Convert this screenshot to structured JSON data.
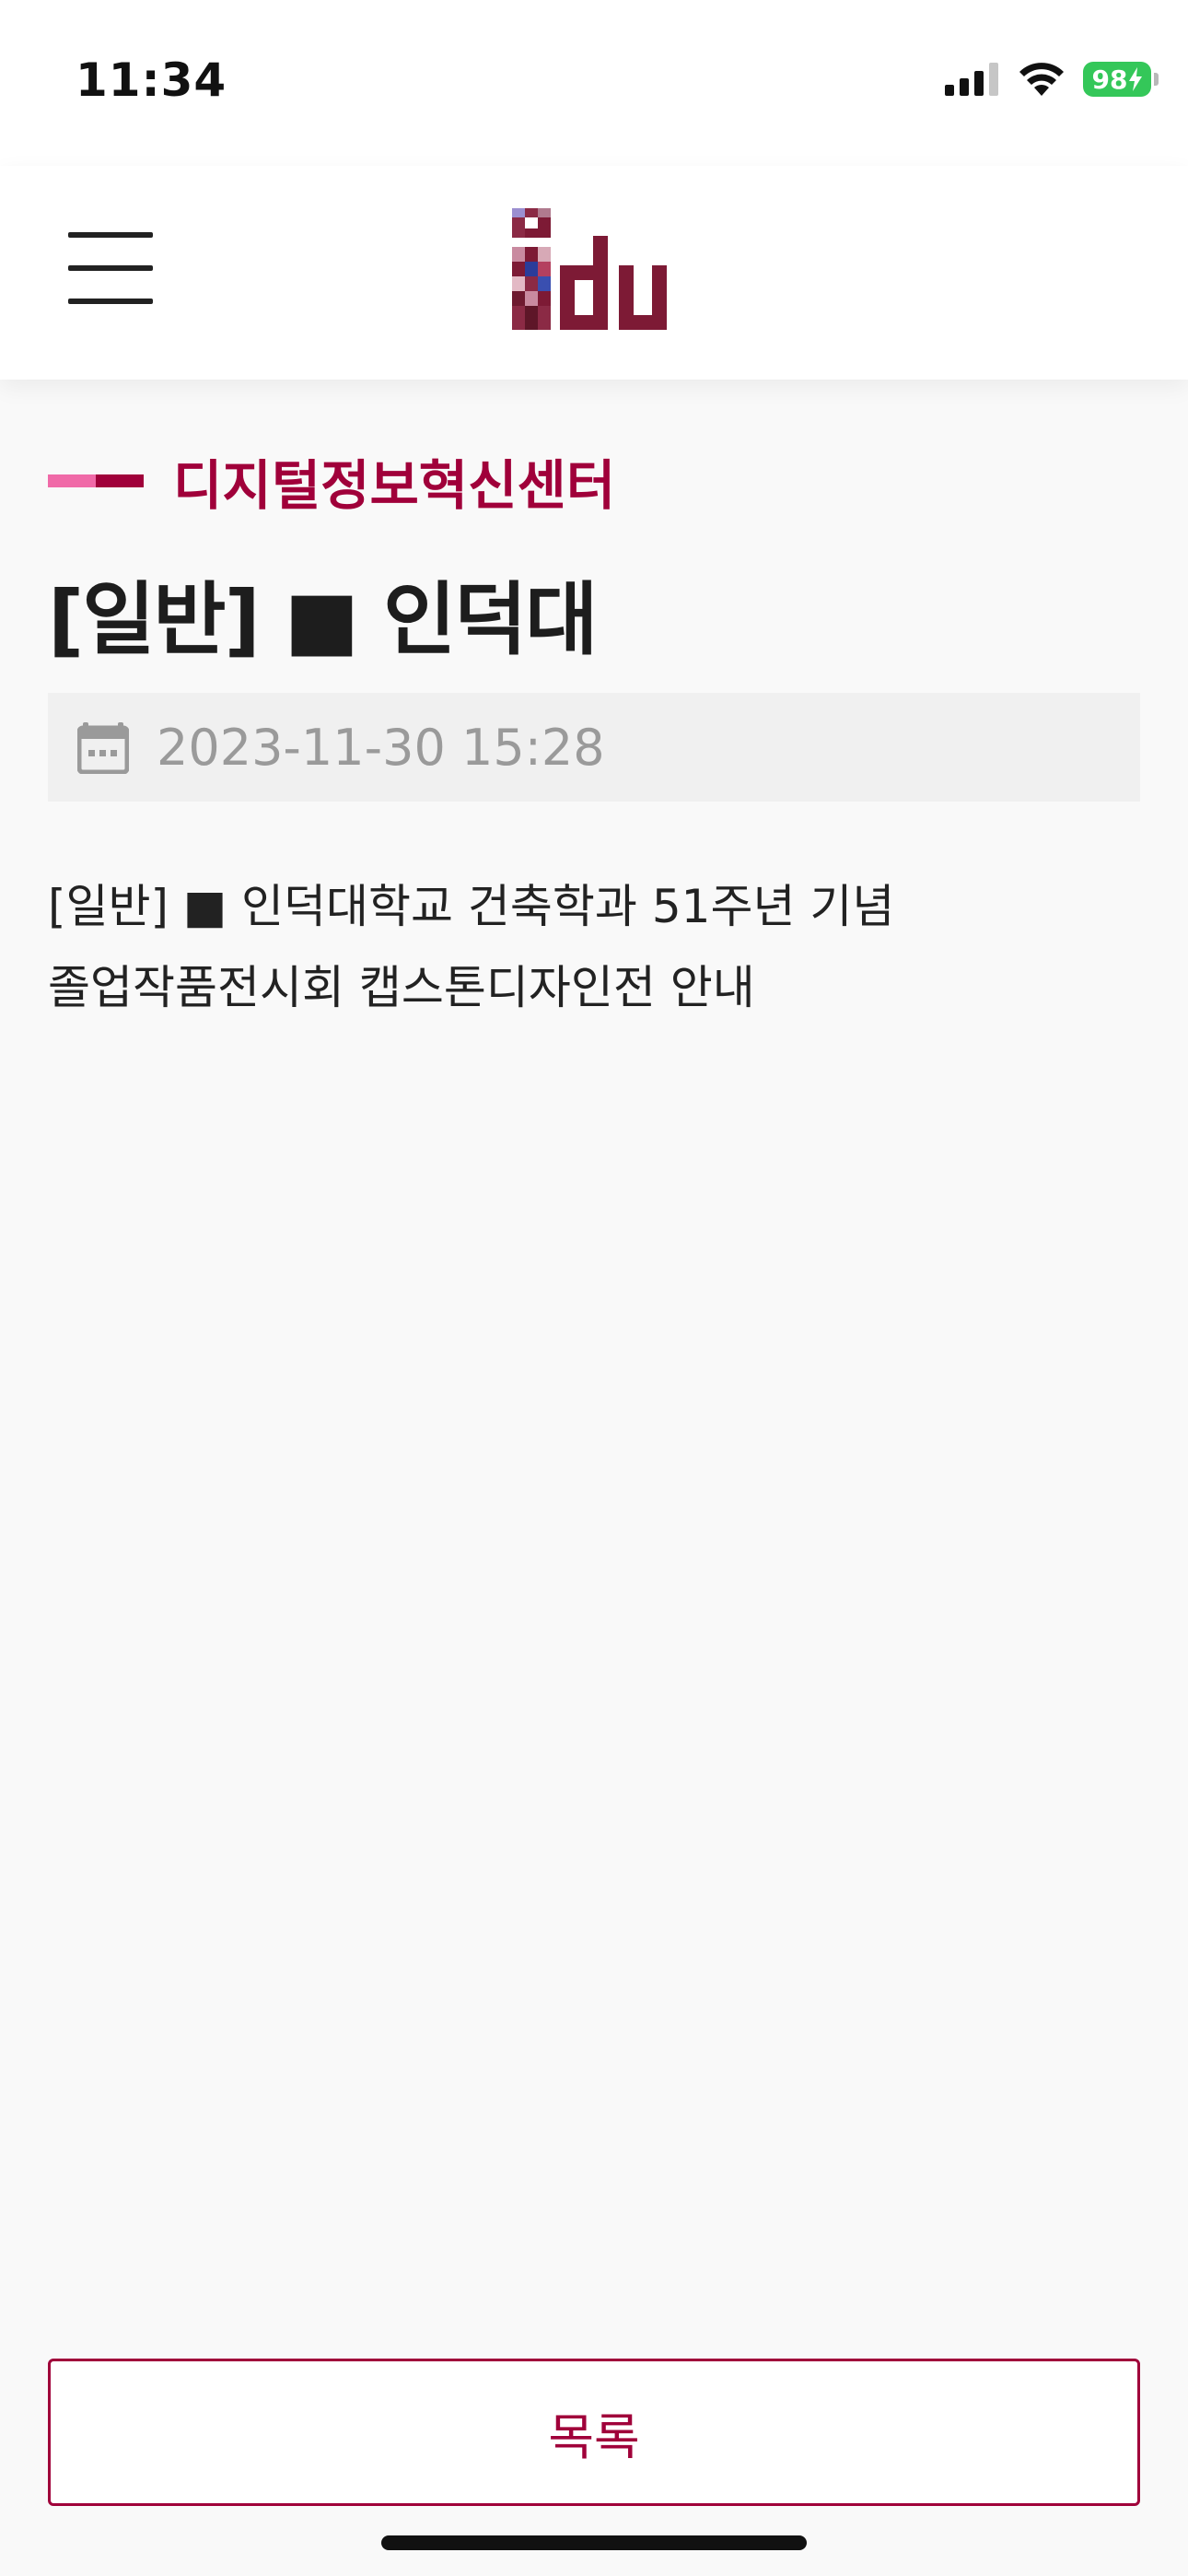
{
  "status_bar": {
    "time": "11:34",
    "battery_level": "98"
  },
  "header": {
    "logo_text": "idu"
  },
  "post": {
    "category": "디지털정보혁신센터",
    "title": "[일반] ■ 인덕대",
    "date": "2023-11-30 15:28",
    "body_line_1": "[일반] ■ 인덕대학교 건축학과 51주년 기념",
    "body_line_2": "졸업작품전시회 캡스톤디자인전 안내"
  },
  "footer": {
    "list_button_label": "목록"
  },
  "colors": {
    "accent": "#a0003a",
    "accent_light": "#f06aa8",
    "battery": "#34c759",
    "logo": "#7d1a35"
  }
}
